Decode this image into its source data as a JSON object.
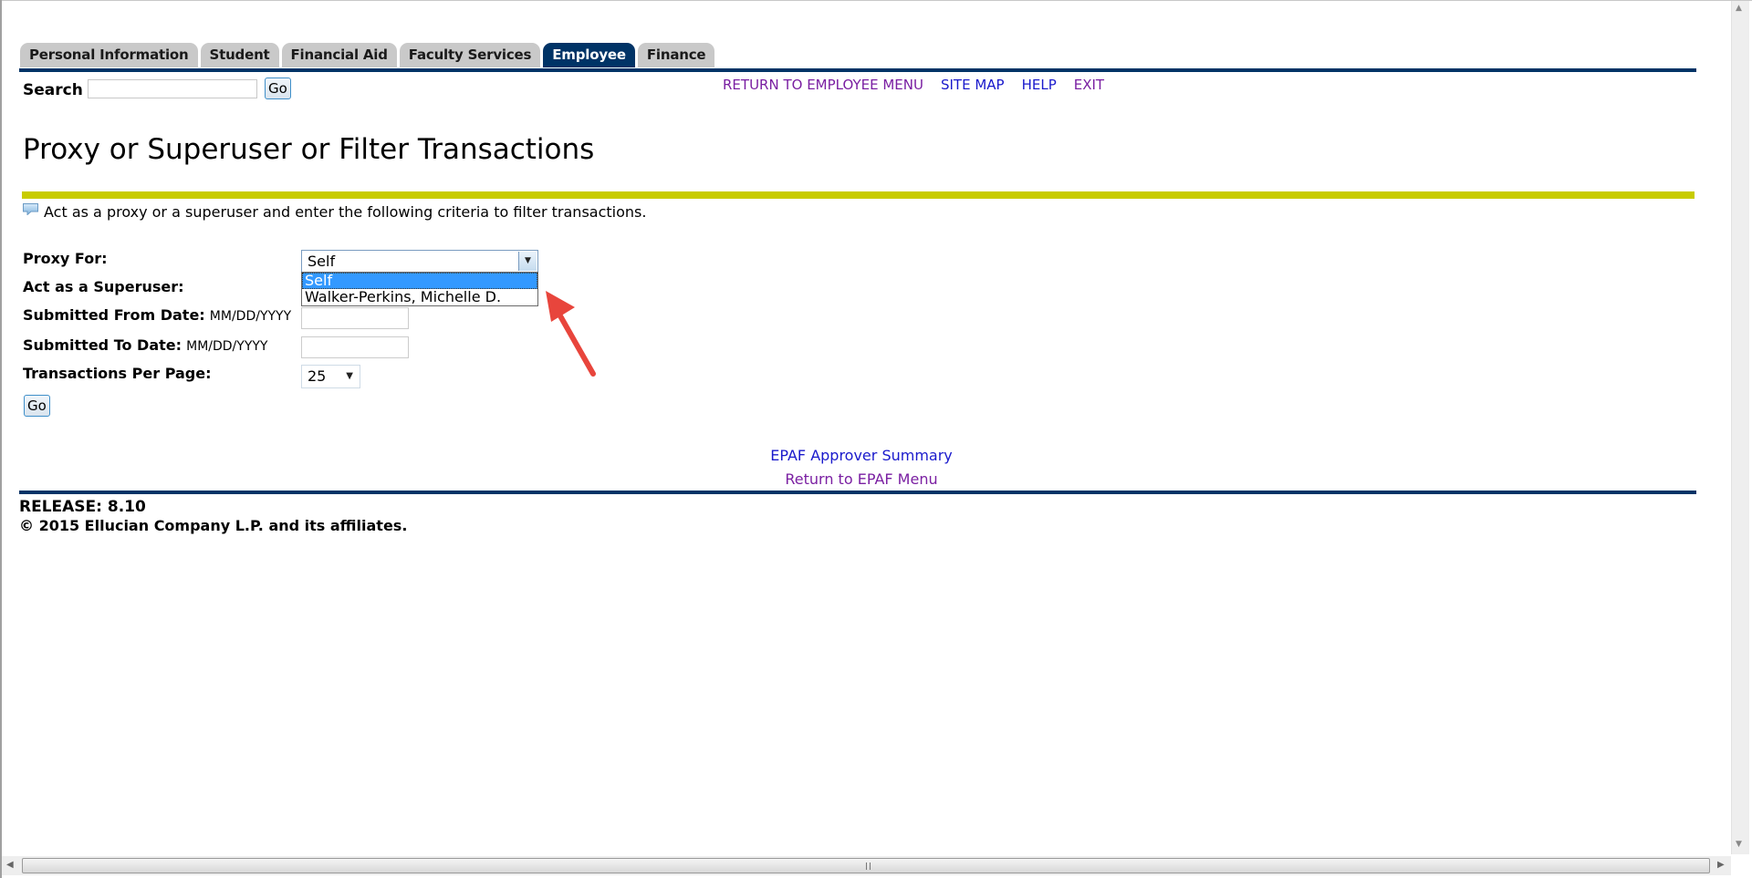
{
  "tabs": [
    {
      "label": "Personal Information",
      "active": false
    },
    {
      "label": "Student",
      "active": false
    },
    {
      "label": "Financial Aid",
      "active": false
    },
    {
      "label": "Faculty Services",
      "active": false
    },
    {
      "label": "Employee",
      "active": true
    },
    {
      "label": "Finance",
      "active": false
    }
  ],
  "search": {
    "label": "Search",
    "value": "",
    "go_label": "Go"
  },
  "toplinks": [
    {
      "label": "RETURN TO EMPLOYEE MENU",
      "visited": true
    },
    {
      "label": "SITE MAP",
      "visited": false
    },
    {
      "label": "HELP",
      "visited": false
    },
    {
      "label": "EXIT",
      "visited": true
    }
  ],
  "page": {
    "title": "Proxy or Superuser or Filter Transactions",
    "info": "Act as a proxy or a superuser and enter the following criteria to filter transactions."
  },
  "form": {
    "proxy_for": {
      "label": "Proxy For:",
      "value": "Self",
      "options": [
        "Self",
        "Walker-Perkins, Michelle D."
      ],
      "highlighted": "Self"
    },
    "superuser": {
      "label": "Act as a Superuser:"
    },
    "from_date": {
      "label": "Submitted From Date:",
      "hint": "MM/DD/YYYY",
      "value": ""
    },
    "to_date": {
      "label": "Submitted To Date:",
      "hint": "MM/DD/YYYY",
      "value": ""
    },
    "per_page": {
      "label": "Transactions Per Page:",
      "value": "25"
    },
    "go_label": "Go"
  },
  "links": {
    "approver_summary": "EPAF Approver Summary",
    "return_menu": "Return to EPAF Menu"
  },
  "footer": {
    "release": "RELEASE: 8.10",
    "copyright": "© 2015 Ellucian Company L.P. and its affiliates."
  },
  "colors": {
    "navy": "#003366",
    "accent_bar": "#c8cc00",
    "link_visited": "#7a1fa2",
    "link": "#1a1acc",
    "selection": "#3399ff",
    "annotation_arrow": "#e8453c"
  }
}
